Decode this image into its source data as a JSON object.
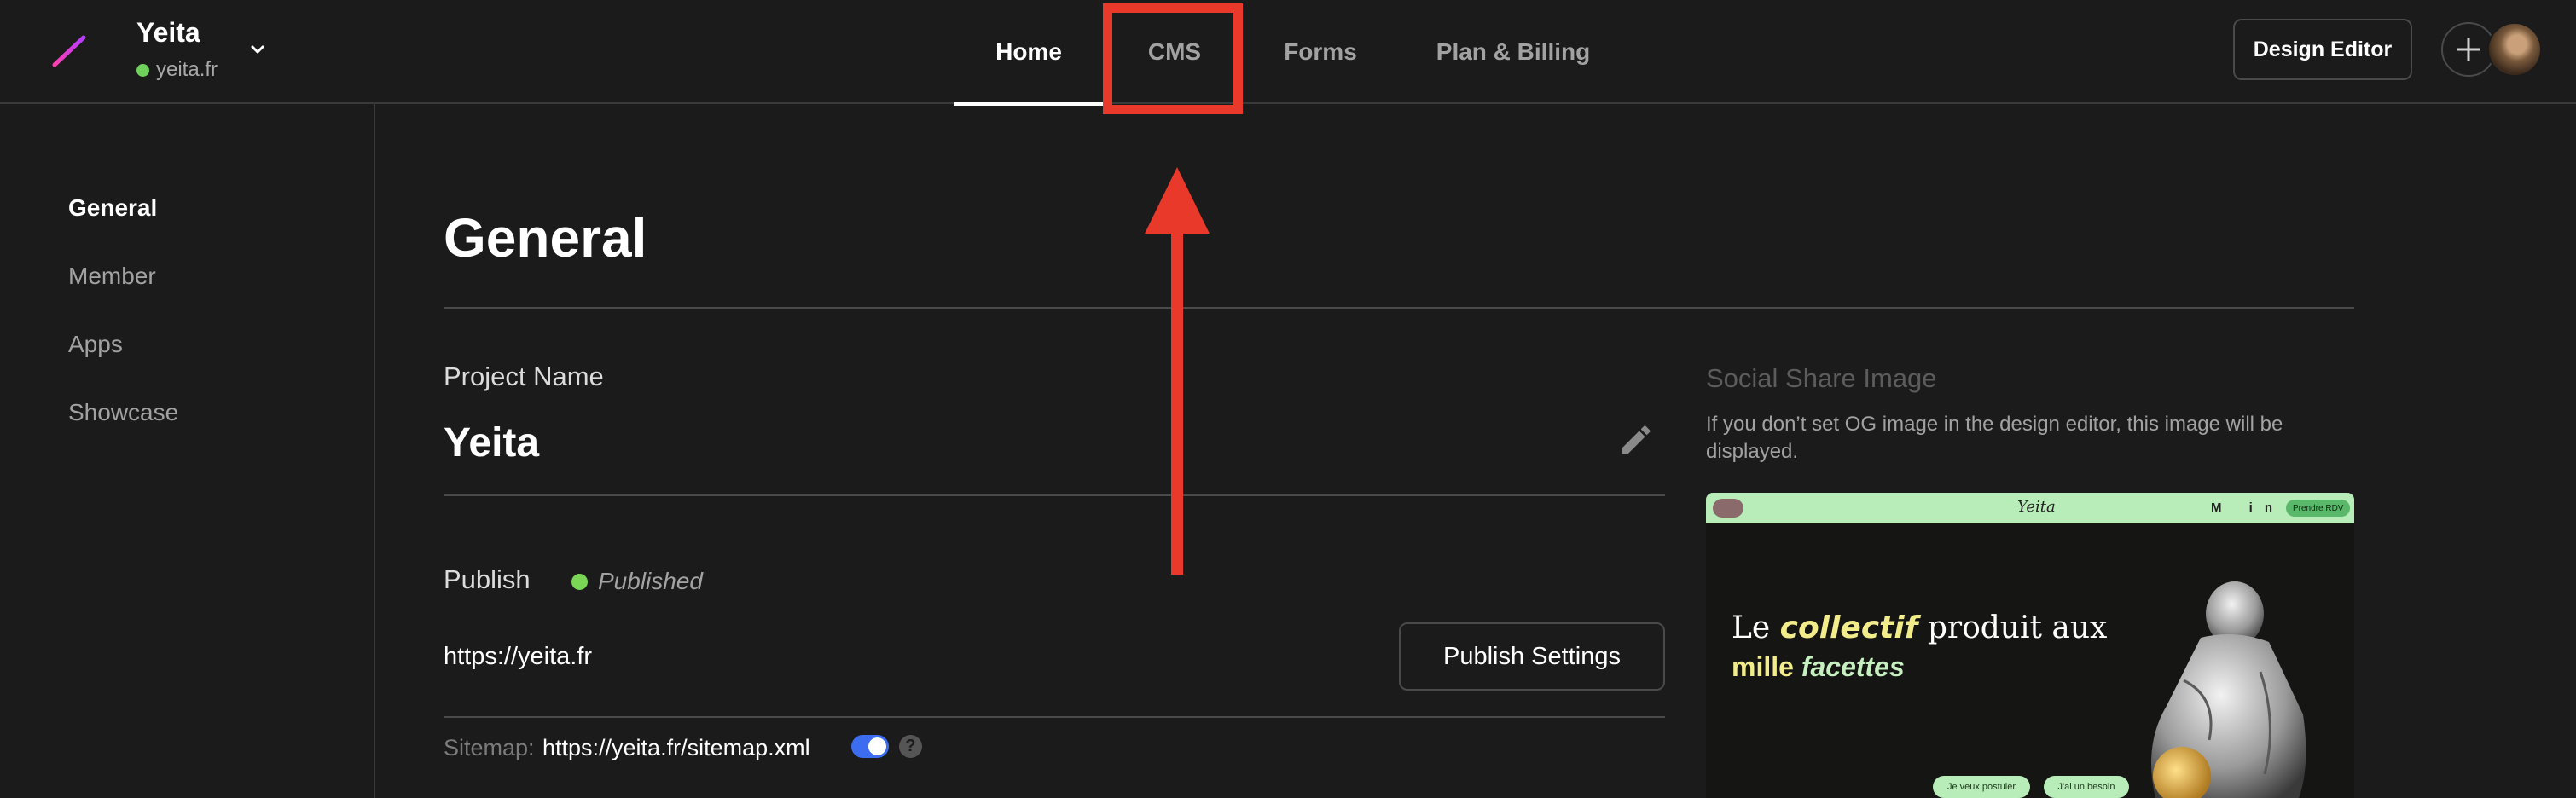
{
  "project": {
    "name": "Yeita",
    "domain": "yeita.fr"
  },
  "nav": {
    "tabs": [
      {
        "label": "Home",
        "active": true
      },
      {
        "label": "CMS",
        "active": false
      },
      {
        "label": "Forms",
        "active": false
      },
      {
        "label": "Plan & Billing",
        "active": false
      }
    ]
  },
  "header": {
    "design_editor_label": "Design Editor"
  },
  "sidebar": {
    "items": [
      {
        "label": "General",
        "active": true
      },
      {
        "label": "Member",
        "active": false
      },
      {
        "label": "Apps",
        "active": false
      },
      {
        "label": "Showcase",
        "active": false
      }
    ]
  },
  "main": {
    "title": "General",
    "project_name_label": "Project Name",
    "project_name_value": "Yeita",
    "publish_label": "Publish",
    "publish_status": "Published",
    "published_url": "https://yeita.fr",
    "publish_settings_label": "Publish Settings",
    "sitemap_label": "Sitemap:",
    "sitemap_url": "https://yeita.fr/sitemap.xml",
    "sitemap_enabled": true,
    "help_glyph": "?"
  },
  "social": {
    "title": "Social Share Image",
    "description": "If you don’t set OG image in the design editor, this image will be displayed.",
    "preview": {
      "brand": "Yeita",
      "nav_icons": "M in ✕",
      "cta": "Prendre RDV",
      "headline_part1": "Le ",
      "headline_em": "collectif",
      "headline_part2": " produit aux",
      "headline2_part1": "mille ",
      "headline2_em": "facettes",
      "pill1": "Je veux postuler",
      "pill2": "J'ai un besoin"
    }
  },
  "colors": {
    "background": "#1b1b1b",
    "accent_toggle": "#3c6cf0",
    "status_green": "#79d755",
    "annotation_red": "#e8392b"
  },
  "icons": {
    "logo": "slash-logo-icon",
    "chevron": "chevron-down-icon",
    "plus": "plus-icon",
    "pencil": "pencil-icon",
    "help": "help-icon"
  }
}
